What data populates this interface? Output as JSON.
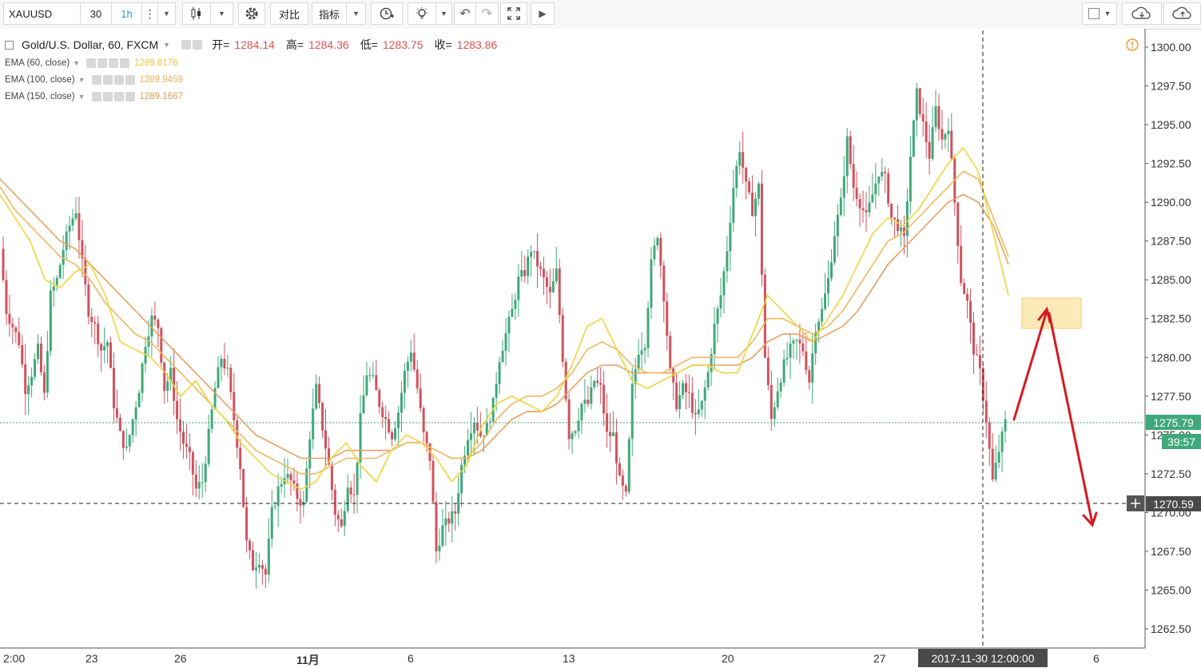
{
  "toolbar": {
    "symbol": "XAUUSD",
    "interval": "30",
    "interval_active": "1h",
    "compare_label": "对比",
    "indicators_label": "指标"
  },
  "legend": {
    "title": "Gold/U.S. Dollar, 60, FXCM",
    "open_label": "开=",
    "open_value": "1284.14",
    "high_label": "高=",
    "high_value": "1284.36",
    "low_label": "低=",
    "low_value": "1283.75",
    "close_label": "收=",
    "close_value": "1283.86",
    "ema": [
      {
        "name": "EMA (60, close)",
        "value": "1289.8176",
        "color": "#f2d33c"
      },
      {
        "name": "EMA (100, close)",
        "value": "1289.9459",
        "color": "#f0b860"
      },
      {
        "name": "EMA (150, close)",
        "value": "1289.1667",
        "color": "#e8a060"
      }
    ]
  },
  "chart_data": {
    "type": "candlestick",
    "symbol": "XAUUSD",
    "ylim": [
      1261.5,
      1301.0
    ],
    "yticks": [
      "1300.00",
      "1297.50",
      "1295.00",
      "1292.50",
      "1290.00",
      "1287.50",
      "1285.00",
      "1282.50",
      "1280.00",
      "1277.50",
      "1275.00",
      "1272.50",
      "1270.00",
      "1267.50",
      "1265.00",
      "1262.50"
    ],
    "xticks": [
      "2:00",
      "23",
      "26",
      "11月",
      "6",
      "13",
      "20",
      "27",
      "6"
    ],
    "current_price": "1275.79",
    "countdown": "39:57",
    "crosshair_price": "1270.59",
    "crosshair_time": "2017-11-30 12:00:00",
    "up_color": "#3fa87a",
    "down_color": "#d0525e",
    "price_path": [
      1287.0,
      1283.0,
      1282.0,
      1281.0,
      1278.0,
      1279.0,
      1280.5,
      1277.5,
      1284.0,
      1285.0,
      1287.0,
      1288.5,
      1289.5,
      1286.0,
      1283.0,
      1282.0,
      1280.5,
      1281.0,
      1277.0,
      1275.0,
      1274.0,
      1276.0,
      1278.0,
      1281.0,
      1282.5,
      1282.0,
      1278.0,
      1279.0,
      1276.0,
      1274.5,
      1273.5,
      1271.5,
      1272.0,
      1275.0,
      1278.0,
      1280.0,
      1279.0,
      1276.0,
      1273.0,
      1268.0,
      1266.5,
      1267.0,
      1266.0,
      1270.0,
      1271.5,
      1272.5,
      1272.0,
      1271.0,
      1270.5,
      1275.0,
      1278.0,
      1275.5,
      1273.0,
      1270.0,
      1269.0,
      1272.0,
      1271.0,
      1276.0,
      1279.0,
      1278.5,
      1277.0,
      1276.0,
      1275.0,
      1276.5,
      1279.0,
      1280.5,
      1278.0,
      1275.0,
      1273.5,
      1267.5,
      1269.0,
      1269.5,
      1270.0,
      1273.0,
      1275.0,
      1276.0,
      1275.0,
      1275.5,
      1277.0,
      1280.0,
      1281.5,
      1283.0,
      1285.0,
      1285.5,
      1287.0,
      1286.0,
      1285.0,
      1284.0,
      1285.5,
      1280.0,
      1275.0,
      1275.5,
      1277.0,
      1277.0,
      1278.5,
      1278.0,
      1275.0,
      1275.0,
      1272.0,
      1271.0,
      1278.0,
      1280.5,
      1281.0,
      1286.0,
      1288.0,
      1284.0,
      1279.0,
      1277.0,
      1278.0,
      1277.5,
      1276.0,
      1277.0,
      1279.0,
      1282.0,
      1284.0,
      1287.0,
      1291.0,
      1293.5,
      1291.0,
      1289.5,
      1291.0,
      1280.0,
      1276.0,
      1278.0,
      1279.5,
      1280.5,
      1281.0,
      1280.5,
      1278.5,
      1282.0,
      1283.0,
      1285.0,
      1288.0,
      1290.0,
      1294.0,
      1291.0,
      1290.0,
      1289.0,
      1290.5,
      1292.0,
      1291.5,
      1289.0,
      1288.5,
      1287.5,
      1293.0,
      1297.0,
      1295.0,
      1293.0,
      1296.0,
      1294.0,
      1295.0,
      1290.0,
      1285.0,
      1283.5,
      1280.5,
      1279.0,
      1276.0,
      1272.0,
      1274.0,
      1275.8
    ],
    "ema_60_path": [
      1290.5,
      1289.0,
      1287.5,
      1285.0,
      1284.5,
      1285.5,
      1286.0,
      1284.0,
      1281.0,
      1280.5,
      1280.0,
      1279.0,
      1277.5,
      1278.5,
      1277.0,
      1276.0,
      1274.5,
      1273.5,
      1272.5,
      1272.0,
      1271.5,
      1272.0,
      1273.5,
      1274.5,
      1273.0,
      1272.0,
      1274.0,
      1275.0,
      1274.5,
      1273.5,
      1272.0,
      1273.0,
      1275.5,
      1277.0,
      1277.5,
      1277.0,
      1276.5,
      1277.5,
      1279.5,
      1282.0,
      1282.5,
      1280.5,
      1278.5,
      1278.0,
      1278.5,
      1279.0,
      1279.5,
      1279.5,
      1279.0,
      1279.0,
      1281.5,
      1284.0,
      1283.0,
      1282.0,
      1281.0,
      1282.5,
      1284.0,
      1286.0,
      1288.0,
      1289.0,
      1288.5,
      1289.5,
      1291.0,
      1292.5,
      1293.5,
      1292.0,
      1288.0,
      1284.0
    ],
    "ema_100_path": [
      1291.0,
      1289.5,
      1288.5,
      1287.5,
      1286.5,
      1286.0,
      1285.0,
      1283.5,
      1282.5,
      1281.5,
      1281.0,
      1280.0,
      1279.0,
      1278.0,
      1277.0,
      1276.0,
      1275.0,
      1274.0,
      1273.5,
      1273.0,
      1272.5,
      1272.5,
      1273.0,
      1273.5,
      1273.5,
      1273.5,
      1274.0,
      1274.5,
      1274.5,
      1274.0,
      1273.5,
      1273.5,
      1274.5,
      1276.0,
      1277.0,
      1277.5,
      1277.5,
      1278.0,
      1279.0,
      1280.5,
      1281.0,
      1280.5,
      1279.5,
      1279.0,
      1279.0,
      1279.5,
      1280.0,
      1280.0,
      1280.0,
      1280.0,
      1281.0,
      1282.5,
      1282.5,
      1282.0,
      1281.5,
      1282.0,
      1283.0,
      1284.5,
      1286.0,
      1287.5,
      1288.0,
      1289.0,
      1290.0,
      1291.0,
      1292.0,
      1291.5,
      1289.0,
      1286.5
    ],
    "ema_150_path": [
      1291.5,
      1290.5,
      1289.5,
      1288.5,
      1287.5,
      1287.0,
      1286.0,
      1285.0,
      1284.0,
      1283.0,
      1282.0,
      1281.0,
      1280.0,
      1279.0,
      1278.0,
      1277.0,
      1276.0,
      1275.0,
      1274.5,
      1274.0,
      1273.5,
      1273.5,
      1273.5,
      1274.0,
      1274.0,
      1274.0,
      1274.0,
      1274.5,
      1274.5,
      1274.0,
      1273.5,
      1273.5,
      1274.0,
      1275.0,
      1276.0,
      1276.5,
      1276.5,
      1277.0,
      1278.0,
      1279.0,
      1279.5,
      1279.5,
      1279.0,
      1279.0,
      1279.0,
      1279.0,
      1279.5,
      1279.5,
      1279.5,
      1279.5,
      1280.0,
      1281.0,
      1281.5,
      1281.5,
      1281.0,
      1281.5,
      1282.0,
      1283.0,
      1284.5,
      1286.0,
      1287.0,
      1288.0,
      1289.0,
      1290.0,
      1290.5,
      1290.0,
      1288.5,
      1286.0
    ]
  }
}
